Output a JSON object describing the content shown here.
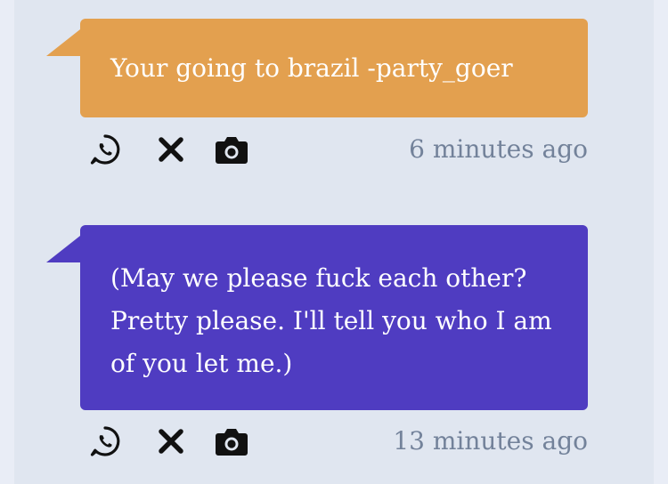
{
  "messages": [
    {
      "text": "Your going to brazil -party_goer",
      "timestamp": "6 minutes ago",
      "color": "#e3a04f"
    },
    {
      "text": "(May we please fuck each other? Pretty please. I'll tell you who I am of you let me.)",
      "timestamp": "13 minutes ago",
      "color": "#4f3cc1"
    }
  ],
  "icons": {
    "share": "whatsapp-icon",
    "dismiss": "close-icon",
    "snapshot": "camera-icon"
  },
  "colors": {
    "background": "#e9edf6",
    "panel": "#e0e6f0",
    "timestamp": "#73829a",
    "icon": "#111111"
  }
}
